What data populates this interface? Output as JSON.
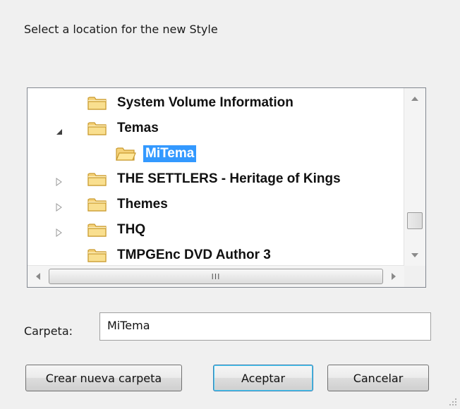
{
  "dialog": {
    "prompt": "Select a location for the new Style"
  },
  "tree": {
    "items": [
      {
        "label": "System Volume Information",
        "expander": "none",
        "depth": 1,
        "selected": false
      },
      {
        "label": "Temas",
        "expander": "open",
        "depth": 1,
        "selected": false
      },
      {
        "label": "MiTema",
        "expander": "none",
        "depth": 2,
        "selected": true
      },
      {
        "label": "THE SETTLERS - Heritage of Kings",
        "expander": "closed",
        "depth": 1,
        "selected": false
      },
      {
        "label": "Themes",
        "expander": "closed",
        "depth": 1,
        "selected": false
      },
      {
        "label": "THQ",
        "expander": "closed",
        "depth": 1,
        "selected": false
      },
      {
        "label": "TMPGEnc DVD Author 3",
        "expander": "none",
        "depth": 1,
        "selected": false
      }
    ],
    "hscroll_grip": "III"
  },
  "folder_field": {
    "label": "Carpeta:",
    "value": "MiTema"
  },
  "buttons": {
    "new_folder": "Crear nueva carpeta",
    "ok": "Aceptar",
    "cancel": "Cancelar"
  },
  "colors": {
    "selection": "#3399ff",
    "folder_fill": "#f5d27a",
    "folder_edge": "#c99a2e"
  }
}
